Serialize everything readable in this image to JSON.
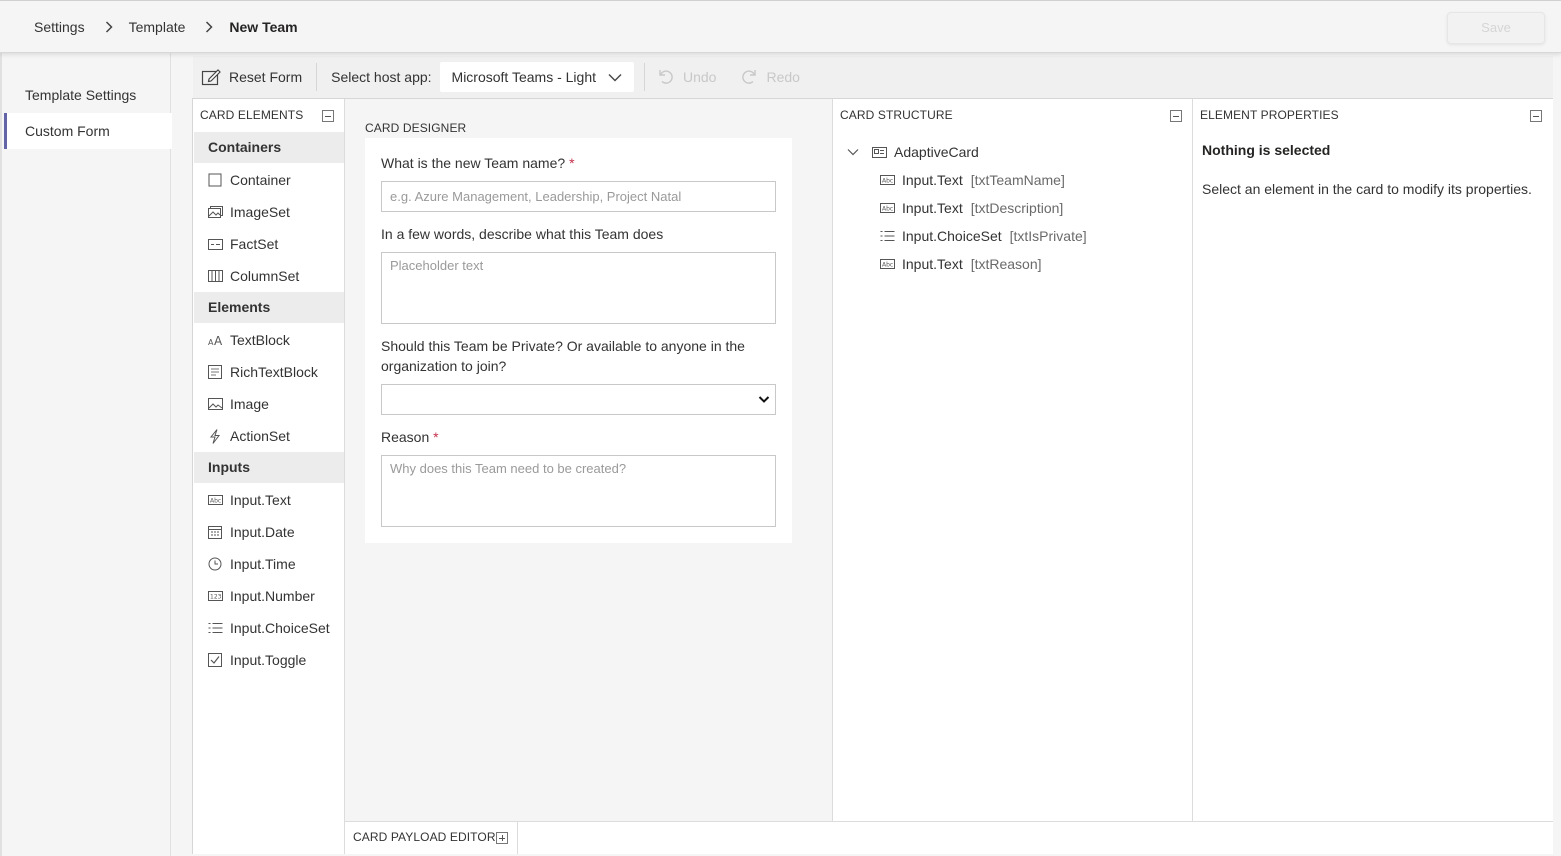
{
  "breadcrumb": {
    "items": [
      "Settings",
      "Template"
    ],
    "current": "New Team"
  },
  "save_label": "Save",
  "nav": {
    "items": [
      {
        "label": "Template Settings",
        "active": false
      },
      {
        "label": "Custom Form",
        "active": true
      }
    ]
  },
  "toolbar": {
    "reset_label": "Reset Form",
    "host_label": "Select host app:",
    "host_value": "Microsoft Teams - Light",
    "undo_label": "Undo",
    "redo_label": "Redo"
  },
  "card_elements": {
    "title": "CARD ELEMENTS",
    "groups": [
      {
        "name": "Containers",
        "items": [
          "Container",
          "ImageSet",
          "FactSet",
          "ColumnSet"
        ]
      },
      {
        "name": "Elements",
        "items": [
          "TextBlock",
          "RichTextBlock",
          "Image",
          "ActionSet"
        ]
      },
      {
        "name": "Inputs",
        "items": [
          "Input.Text",
          "Input.Date",
          "Input.Time",
          "Input.Number",
          "Input.ChoiceSet",
          "Input.Toggle"
        ]
      }
    ],
    "icons": [
      "container-icon",
      "imageset-icon",
      "factset-icon",
      "columnset-icon",
      "textblock-icon",
      "richtextblock-icon",
      "image-icon",
      "actionset-icon",
      "input-text-icon",
      "input-date-icon",
      "input-time-icon",
      "input-number-icon",
      "input-choiceset-icon",
      "input-toggle-icon"
    ]
  },
  "designer": {
    "title": "CARD DESIGNER",
    "q1_label": "What is the new Team name?",
    "q1_required": "*",
    "q1_placeholder": "e.g. Azure Management, Leadership, Project Natal",
    "q2_label": "In a few words, describe what this Team does",
    "q2_placeholder": "Placeholder text",
    "q3_label_line1": "Should this Team be Private? Or available to anyone in the",
    "q3_label_line2": "organization to join?",
    "q4_label": "Reason",
    "q4_required": "*",
    "q4_placeholder": "Why does this Team need to be created?"
  },
  "structure": {
    "title": "CARD STRUCTURE",
    "root": "AdaptiveCard",
    "children": [
      {
        "type": "Input.Text",
        "id": "[txtTeamName]"
      },
      {
        "type": "Input.Text",
        "id": "[txtDescription]"
      },
      {
        "type": "Input.ChoiceSet",
        "id": "[txtIsPrivate]"
      },
      {
        "type": "Input.Text",
        "id": "[txtReason]"
      }
    ]
  },
  "properties": {
    "title": "ELEMENT PROPERTIES",
    "heading": "Nothing is selected",
    "hint": "Select an element in the card to modify its properties."
  },
  "payload_editor": {
    "title": "CARD PAYLOAD EDITOR"
  },
  "colors": {
    "accent": "#6264a7",
    "required": "#c4314b"
  }
}
